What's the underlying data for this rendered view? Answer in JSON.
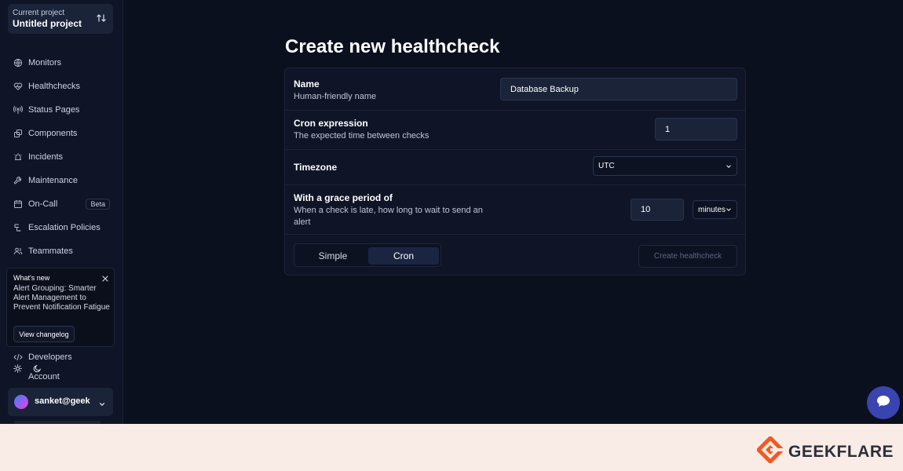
{
  "sidebar": {
    "project_label": "Current project",
    "project_name": "Untitled project",
    "items": [
      {
        "label": "Monitors",
        "icon": "globe-icon"
      },
      {
        "label": "Healthchecks",
        "icon": "heart-pulse-icon"
      },
      {
        "label": "Status Pages",
        "icon": "broadcast-icon"
      },
      {
        "label": "Components",
        "icon": "components-icon"
      },
      {
        "label": "Incidents",
        "icon": "siren-icon"
      },
      {
        "label": "Maintenance",
        "icon": "wrench-icon"
      },
      {
        "label": "On-Call",
        "icon": "calendar-icon",
        "badge": "Beta"
      },
      {
        "label": "Escalation Policies",
        "icon": "escalation-icon"
      },
      {
        "label": "Teammates",
        "icon": "users-icon"
      }
    ],
    "whats_new": {
      "title": "What's new",
      "text": "Alert Grouping: Smarter Alert Management to Prevent Notification Fatigue",
      "button": "View changelog"
    },
    "developers_label": "Developers",
    "account_label": "Account",
    "user_email": "sanket@geek"
  },
  "main": {
    "title": "Create new healthcheck",
    "form": {
      "name": {
        "title": "Name",
        "desc": "Human-friendly name",
        "value": "Database Backup"
      },
      "cron": {
        "title": "Cron expression",
        "desc": "The expected time between checks",
        "value": "1"
      },
      "timezone": {
        "title": "Timezone",
        "value": "UTC"
      },
      "grace": {
        "title": "With a grace period of",
        "desc": "When a check is late, how long to wait to send an alert",
        "value": "10",
        "unit": "minutes"
      }
    },
    "mode_toggle": {
      "simple": "Simple",
      "cron": "Cron",
      "active": "Cron"
    },
    "submit_label": "Create healthcheck"
  },
  "footer": {
    "brand": "GEEKFLARE"
  },
  "colors": {
    "bg": "#0b101e",
    "card": "#0f1526",
    "accent": "#3a44b0",
    "brand_orange": "#f05a22"
  }
}
